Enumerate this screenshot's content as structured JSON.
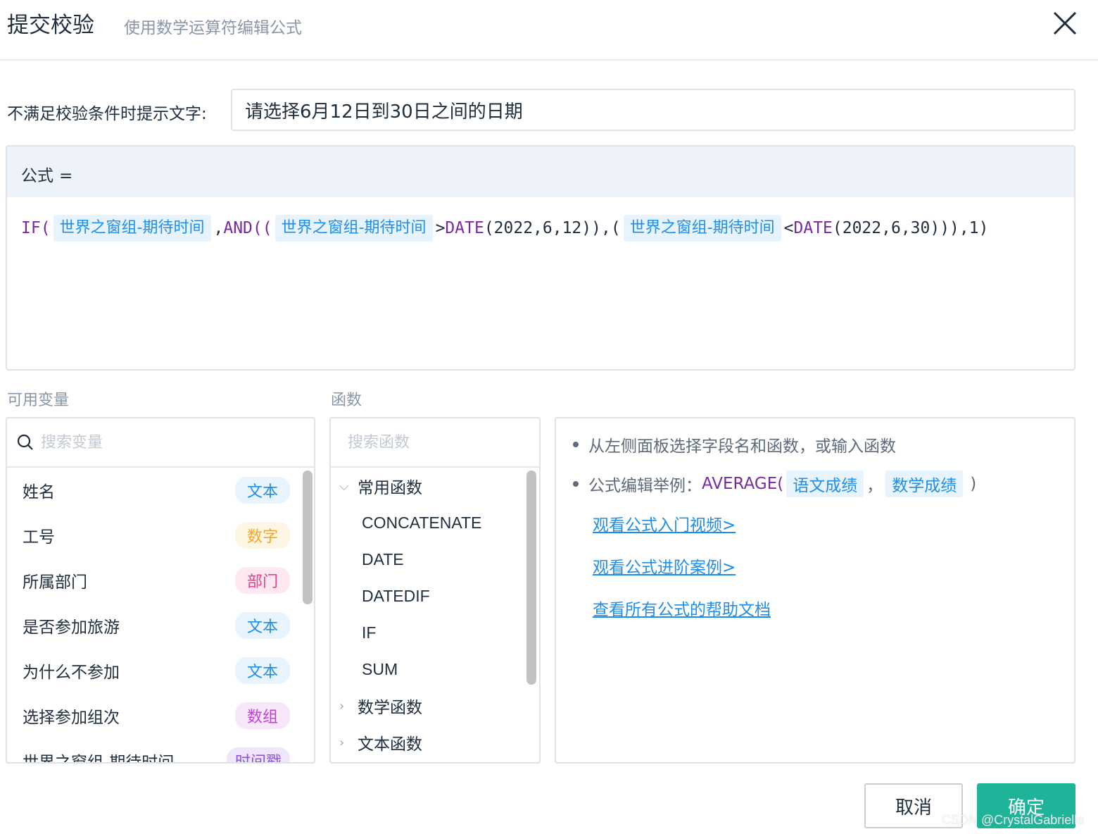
{
  "header": {
    "title": "提交校验",
    "subtitle": "使用数学运算符编辑公式"
  },
  "hint": {
    "label": "不满足校验条件时提示文字:",
    "value": "请选择6月12日到30日之间的日期"
  },
  "formula": {
    "label": "公式",
    "equals": "=",
    "tokens": {
      "t1": "IF(",
      "v1": "世界之窗组-期待时间",
      "t2": ",",
      "f2": "AND((",
      "v2": "世界之窗组-期待时间",
      "t3": ">",
      "f3": "DATE",
      "t3b": "(2022,6,12)),(",
      "v3": "世界之窗组-期待时间",
      "t4": "<",
      "f4": "DATE",
      "t4b": "(2022,6,30))),1)"
    }
  },
  "variables": {
    "label": "可用变量",
    "search_placeholder": "搜索变量",
    "items": [
      {
        "name": "姓名",
        "type": "文本",
        "color": "#1f8ee8",
        "bg": "#e8f4fd"
      },
      {
        "name": "工号",
        "type": "数字",
        "color": "#f5a623",
        "bg": "#fef6e4"
      },
      {
        "name": "所属部门",
        "type": "部门",
        "color": "#e8408a",
        "bg": "#fde8f1"
      },
      {
        "name": "是否参加旅游",
        "type": "文本",
        "color": "#1f8ee8",
        "bg": "#e8f4fd"
      },
      {
        "name": "为什么不参加",
        "type": "文本",
        "color": "#1f8ee8",
        "bg": "#e8f4fd"
      },
      {
        "name": "选择参加组次",
        "type": "数组",
        "color": "#c23fd6",
        "bg": "#f8e6fb"
      },
      {
        "name": "世界之窗组-期待时间",
        "type": "时间戳",
        "color": "#8a4fe0",
        "bg": "#efe6fc"
      }
    ]
  },
  "functions": {
    "label": "函数",
    "search_placeholder": "搜索函数",
    "groups": [
      {
        "name": "常用函数",
        "items": [
          "CONCATENATE",
          "DATE",
          "DATEDIF",
          "IF",
          "SUM"
        ]
      },
      {
        "name": "数学函数"
      },
      {
        "name": "文本函数"
      }
    ]
  },
  "help": {
    "tip1": "从左侧面板选择字段名和函数，或输入函数",
    "tip2_prefix": "公式编辑举例：",
    "tip2_fn": "AVERAGE(",
    "tip2_var1": "语文成绩",
    "tip2_sep": "，",
    "tip2_var2": "数学成绩",
    "tip2_close": ")",
    "link1": "观看公式入门视频>",
    "link2": "观看公式进阶案例>",
    "link3": "查看所有公式的帮助文档"
  },
  "buttons": {
    "cancel": "取消",
    "ok": "确定"
  },
  "watermark": "CSDN @CrystalGabrielle"
}
